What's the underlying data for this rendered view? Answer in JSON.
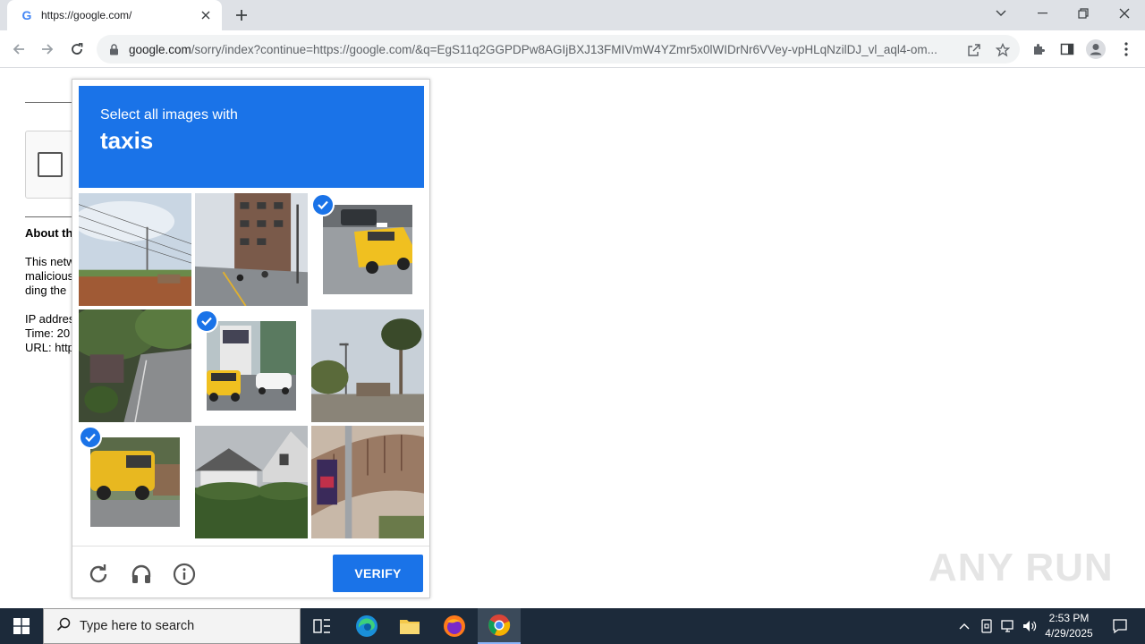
{
  "browser": {
    "tab_title": "https://google.com/",
    "url_host": "google.com",
    "url_path": "/sorry/index?continue=https://google.com/&q=EgS11q2GGPDPw8AGIjBXJ13FMIVmW4YZmr5x0lWIDrNr6VVey-vpHLqNzilDJ_vl_aql4-om..."
  },
  "page": {
    "about_heading": "About th",
    "lines": [
      "This netw",
      "malicious",
      "ding the"
    ],
    "ip_label": "IP addres",
    "time_label": "Time: 20",
    "url_label": "URL: http"
  },
  "captcha": {
    "instruction": "Select all images with",
    "object": "taxis",
    "verify_label": "VERIFY",
    "tiles": [
      {
        "id": 1,
        "selected": false,
        "scene": "field-with-power-lines"
      },
      {
        "id": 2,
        "selected": false,
        "scene": "street-with-building"
      },
      {
        "id": 3,
        "selected": true,
        "scene": "yellow-taxi"
      },
      {
        "id": 4,
        "selected": false,
        "scene": "street-with-trees"
      },
      {
        "id": 5,
        "selected": true,
        "scene": "yellow-taxi-and-bus"
      },
      {
        "id": 6,
        "selected": false,
        "scene": "palm-trees-street"
      },
      {
        "id": 7,
        "selected": true,
        "scene": "yellow-van-taxi"
      },
      {
        "id": 8,
        "selected": false,
        "scene": "house-with-hedge"
      },
      {
        "id": 9,
        "selected": false,
        "scene": "bridge-with-pole"
      }
    ]
  },
  "watermark": "ANY RUN",
  "taskbar": {
    "search_placeholder": "Type here to search",
    "time": "2:53 PM",
    "date": "4/29/2025"
  },
  "colors": {
    "accent": "#1a73e8",
    "taskbar": "#1c2a3a"
  }
}
